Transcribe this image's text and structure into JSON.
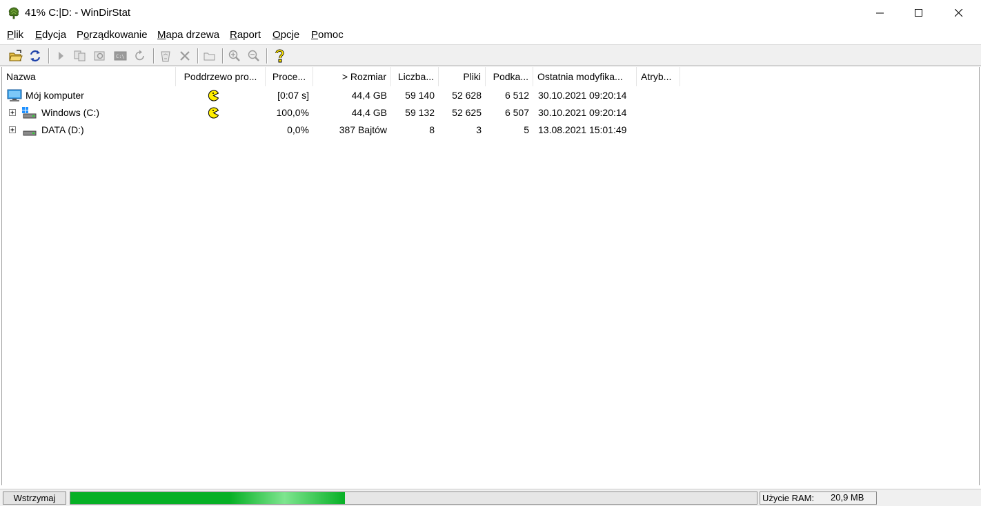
{
  "window": {
    "title": "41% C:|D: - WinDirStat",
    "minimize_glyph": "—",
    "maximize_glyph": "☐",
    "close_glyph": "✕"
  },
  "menu": [
    {
      "label": "Plik",
      "accel": "P",
      "rest": "lik"
    },
    {
      "label": "Edycja",
      "accel": "E",
      "rest": "dycja"
    },
    {
      "label": "Porządkowanie",
      "accel": "o",
      "pre": "P",
      "rest": "rządkowanie"
    },
    {
      "label": "Mapa drzewa",
      "accel": "M",
      "rest": "apa drzewa"
    },
    {
      "label": "Raport",
      "accel": "R",
      "rest": "aport"
    },
    {
      "label": "Opcje",
      "accel": "O",
      "rest": "pcje"
    },
    {
      "label": "Pomoc",
      "accel": "P",
      "rest": "omoc"
    }
  ],
  "toolbar": {
    "icons": [
      "open-folder-icon",
      "refresh-icon",
      "run-icon",
      "copy-path-icon",
      "explorer-icon",
      "command-prompt-icon",
      "refresh-selected-icon",
      "recycle-icon",
      "delete-icon",
      "new-folder-icon",
      "zoom-in-icon",
      "zoom-out-icon",
      "help-icon"
    ]
  },
  "columns": [
    {
      "label": "Nazwa"
    },
    {
      "label": "Poddrzewo pro..."
    },
    {
      "label": "Proce..."
    },
    {
      "label": "> Rozmiar"
    },
    {
      "label": "Liczba..."
    },
    {
      "label": "Pliki"
    },
    {
      "label": "Podka..."
    },
    {
      "label": "Ostatnia modyfika..."
    },
    {
      "label": "Atryb..."
    }
  ],
  "rows": [
    {
      "name": "Mój komputer",
      "icon": "computer-icon",
      "expander": "",
      "subtree": "pacman",
      "percent": "[0:07 s]",
      "size": "44,4 GB",
      "items": "59 140",
      "files": "52 628",
      "subdirs": "6 512",
      "modified": "30.10.2021  09:20:14",
      "attributes": ""
    },
    {
      "name": "Windows (C:)",
      "icon": "windows-drive-icon",
      "expander": "+",
      "subtree": "pacman",
      "percent": "100,0%",
      "size": "44,4 GB",
      "items": "59 132",
      "files": "52 625",
      "subdirs": "6 507",
      "modified": "30.10.2021  09:20:14",
      "attributes": ""
    },
    {
      "name": "DATA (D:)",
      "icon": "drive-icon",
      "expander": "+",
      "subtree": "",
      "percent": "0,0%",
      "size": "387 Bajtów",
      "items": "8",
      "files": "3",
      "subdirs": "5",
      "modified": "13.08.2021  15:01:49",
      "attributes": ""
    }
  ],
  "status": {
    "pause_label": "Wstrzymaj",
    "progress_fraction": 0.4,
    "ram_label": "Użycie RAM:",
    "ram_value": "20,9 MB"
  },
  "colors": {
    "progress": "#06b025",
    "pacman": "#ffee00"
  }
}
